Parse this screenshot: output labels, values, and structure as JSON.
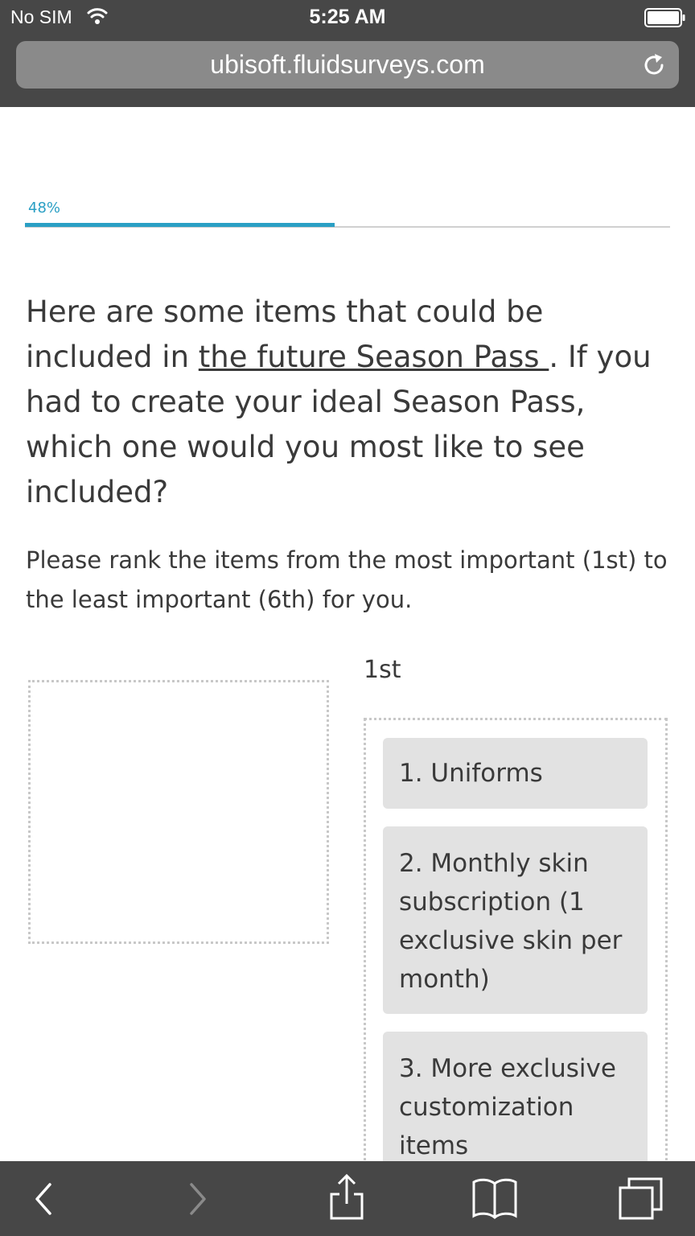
{
  "status_bar": {
    "carrier": "No SIM",
    "time": "5:25 AM"
  },
  "browser": {
    "url": "ubisoft.fluidsurveys.com"
  },
  "progress": {
    "label": "48%",
    "value": 0.48
  },
  "question": {
    "text_before": "Here are some items that could be included in ",
    "link_text": "the future Season Pass ",
    "text_after": ". If you had to create your ideal Season Pass, which one would you most like to see included?"
  },
  "instructions": "Please rank the items from the most important (1st) to the least important (6th) for you.",
  "ranking": {
    "rank_label": "1st",
    "items": [
      "1. Uniforms",
      "2. Monthly skin subscription (1 exclusive skin per month)",
      "3. More exclusive customization items"
    ]
  },
  "colors": {
    "accent": "#2a9fc4",
    "chrome": "#474747",
    "item_bg": "#e2e2e2"
  },
  "icons": {
    "toolbar": [
      "back-icon",
      "forward-icon",
      "share-icon",
      "bookmarks-icon",
      "tabs-icon"
    ]
  }
}
